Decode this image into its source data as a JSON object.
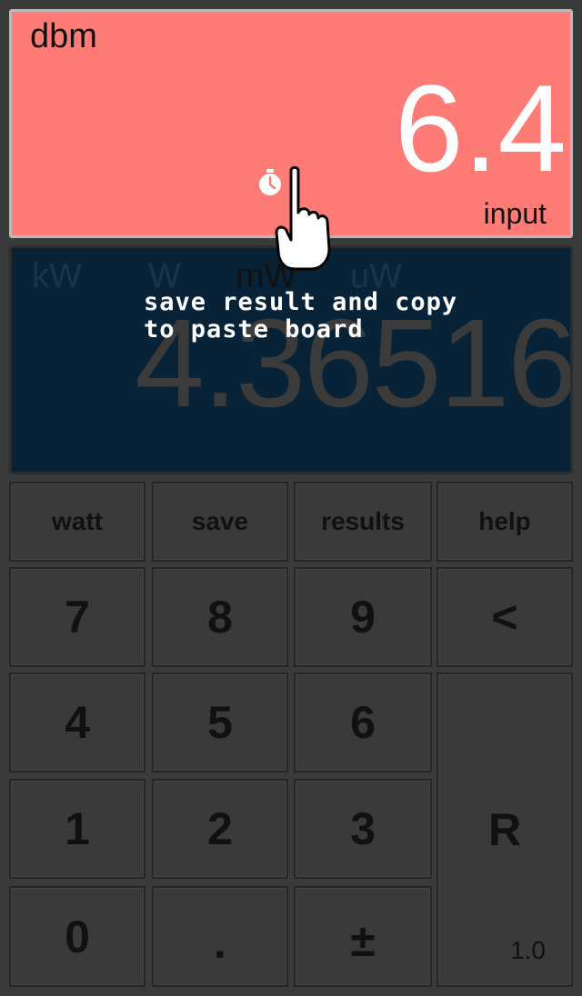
{
  "input": {
    "unit": "dbm",
    "value": "6.4",
    "label": "input"
  },
  "result": {
    "units": [
      "kW",
      "W",
      "mW",
      "uW"
    ],
    "active_unit": "mW",
    "value": "4.36516"
  },
  "hint": {
    "text": "save result and copy\nto paste board"
  },
  "keys": {
    "watt": "watt",
    "save": "save",
    "results": "results",
    "help": "help",
    "k7": "7",
    "k8": "8",
    "k9": "9",
    "backspace": "<",
    "k4": "4",
    "k5": "5",
    "k6": "6",
    "k1": "1",
    "k2": "2",
    "k3": "3",
    "reset": "R",
    "k0": "0",
    "dot": ".",
    "sign": "±"
  },
  "version": "1.0",
  "colors": {
    "input_bg": "#ff7b76",
    "result_bg": "#082338",
    "keypad_bg": "#3a3a3a"
  }
}
